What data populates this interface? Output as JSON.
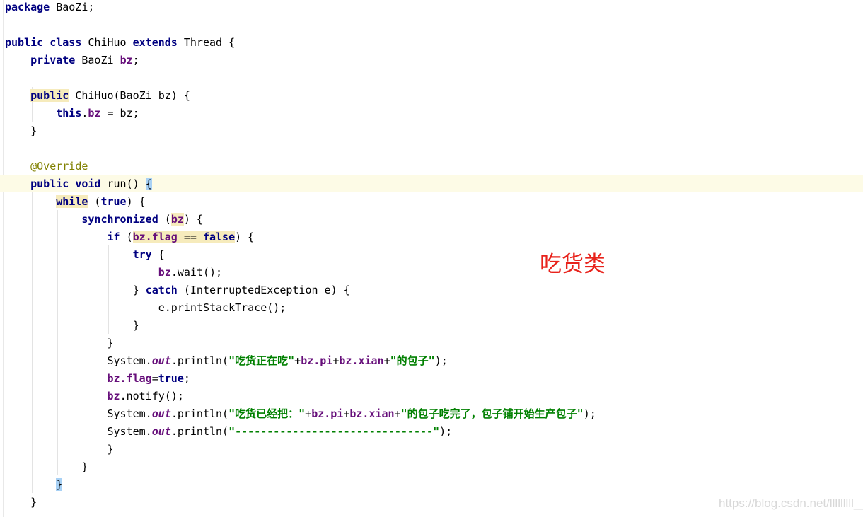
{
  "code": {
    "current_line": 10,
    "lines": [
      [
        [
          "kw",
          "package"
        ],
        [
          "p",
          " BaoZi;"
        ]
      ],
      [],
      [
        [
          "kw",
          "public class"
        ],
        [
          "p",
          " ChiHuo "
        ],
        [
          "kw",
          "extends"
        ],
        [
          "p",
          " Thread {"
        ]
      ],
      [
        [
          "p",
          "    "
        ],
        [
          "kw",
          "private"
        ],
        [
          "p",
          " BaoZi "
        ],
        [
          "field",
          "bz"
        ],
        [
          "p",
          ";"
        ]
      ],
      [],
      [
        [
          "p",
          "    "
        ],
        [
          "kw",
          "public",
          "hl"
        ],
        [
          "p",
          " ChiHuo(BaoZi bz) {"
        ]
      ],
      [
        [
          "p",
          "        "
        ],
        [
          "kw",
          "this"
        ],
        [
          "p",
          "."
        ],
        [
          "field",
          "bz"
        ],
        [
          "p",
          " = bz;"
        ]
      ],
      [
        [
          "p",
          "    }"
        ]
      ],
      [],
      [
        [
          "p",
          "    "
        ],
        [
          "ann",
          "@Override"
        ]
      ],
      [
        [
          "p",
          "    "
        ],
        [
          "kw",
          "public void"
        ],
        [
          "p",
          " run() "
        ],
        [
          "p",
          "{",
          "hlb"
        ]
      ],
      [
        [
          "p",
          "        "
        ],
        [
          "kw",
          "while",
          "hl"
        ],
        [
          "p",
          " ("
        ],
        [
          "kw",
          "true"
        ],
        [
          "p",
          ") {"
        ]
      ],
      [
        [
          "p",
          "            "
        ],
        [
          "kw",
          "synchronized"
        ],
        [
          "p",
          " ("
        ],
        [
          "field",
          "bz",
          "hl"
        ],
        [
          "p",
          ") {"
        ]
      ],
      [
        [
          "p",
          "                "
        ],
        [
          "kw",
          "if"
        ],
        [
          "p",
          " ("
        ],
        [
          "field",
          "bz.flag",
          "hl"
        ],
        [
          "p",
          " == ",
          "hl"
        ],
        [
          "kw",
          "false",
          "hl"
        ],
        [
          "p",
          ") {"
        ]
      ],
      [
        [
          "p",
          "                    "
        ],
        [
          "kw",
          "try"
        ],
        [
          "p",
          " {"
        ]
      ],
      [
        [
          "p",
          "                        "
        ],
        [
          "field",
          "bz"
        ],
        [
          "p",
          ".wait();"
        ]
      ],
      [
        [
          "p",
          "                    } "
        ],
        [
          "kw",
          "catch"
        ],
        [
          "p",
          " (InterruptedException e) {"
        ]
      ],
      [
        [
          "p",
          "                        e.printStackTrace();"
        ]
      ],
      [
        [
          "p",
          "                    }"
        ]
      ],
      [
        [
          "p",
          "                }"
        ]
      ],
      [
        [
          "p",
          "                System."
        ],
        [
          "static",
          "out"
        ],
        [
          "p",
          ".println("
        ],
        [
          "str",
          "\"吃货正在吃\""
        ],
        [
          "p",
          "+"
        ],
        [
          "field",
          "bz.pi"
        ],
        [
          "p",
          "+"
        ],
        [
          "field",
          "bz.xian"
        ],
        [
          "p",
          "+"
        ],
        [
          "str",
          "\"的包子\""
        ],
        [
          "p",
          ");"
        ]
      ],
      [
        [
          "p",
          "                "
        ],
        [
          "field",
          "bz.flag"
        ],
        [
          "p",
          "="
        ],
        [
          "kw",
          "true"
        ],
        [
          "p",
          ";"
        ]
      ],
      [
        [
          "p",
          "                "
        ],
        [
          "field",
          "bz"
        ],
        [
          "p",
          ".notify();"
        ]
      ],
      [
        [
          "p",
          "                System."
        ],
        [
          "static",
          "out"
        ],
        [
          "p",
          ".println("
        ],
        [
          "str",
          "\"吃货已经把：\""
        ],
        [
          "p",
          "+"
        ],
        [
          "field",
          "bz.pi"
        ],
        [
          "p",
          "+"
        ],
        [
          "field",
          "bz.xian"
        ],
        [
          "p",
          "+"
        ],
        [
          "str",
          "\"的包子吃完了，包子铺开始生产包子\""
        ],
        [
          "p",
          ");"
        ]
      ],
      [
        [
          "p",
          "                System."
        ],
        [
          "static",
          "out"
        ],
        [
          "p",
          ".println("
        ],
        [
          "str",
          "\"-------------------------------\""
        ],
        [
          "p",
          ");"
        ]
      ],
      [
        [
          "p",
          "                }"
        ]
      ],
      [
        [
          "p",
          "            }"
        ]
      ],
      [
        [
          "p",
          "        "
        ],
        [
          "p",
          "}",
          "hlb"
        ]
      ],
      [
        [
          "p",
          "    }"
        ]
      ]
    ]
  },
  "annotation_label": "吃货类",
  "watermark": "https://blog.csdn.net/lllllllll__",
  "colors": {
    "keyword": "#000080",
    "field": "#660e7a",
    "string": "#008000",
    "annotation": "#808000",
    "label": "#e8221b"
  }
}
